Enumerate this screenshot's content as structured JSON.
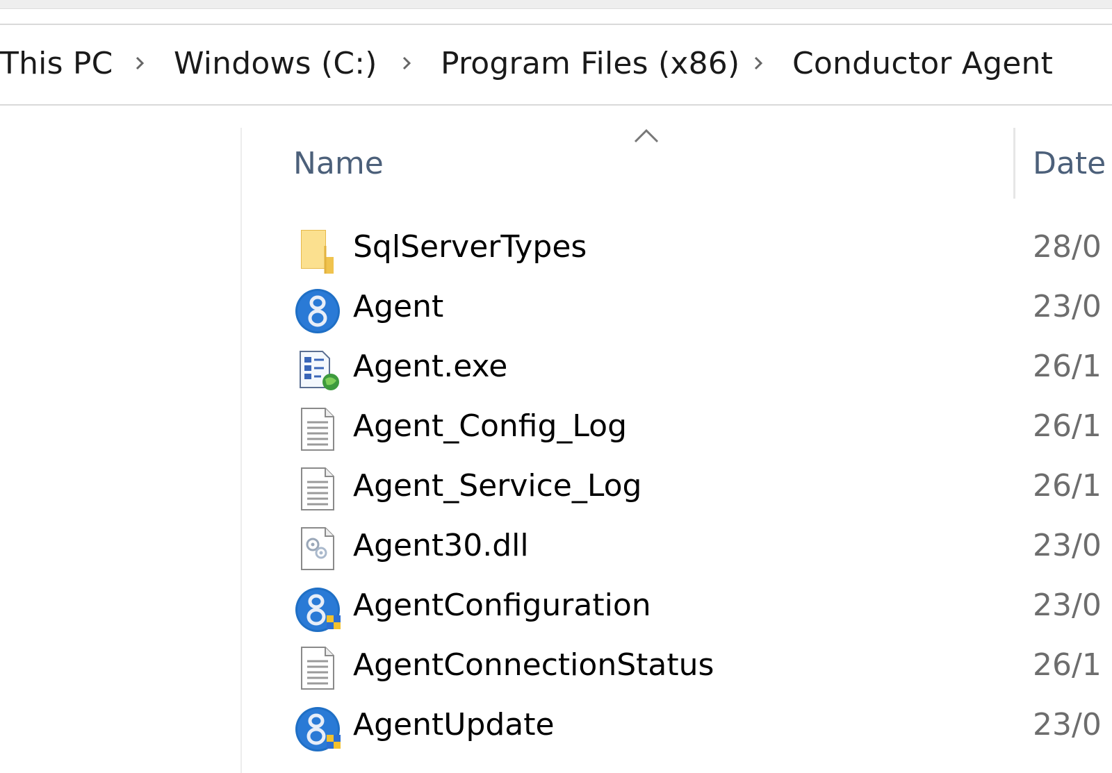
{
  "breadcrumb": {
    "items": [
      "This PC",
      "Windows (C:)",
      "Program Files (x86)",
      "Conductor Agent"
    ]
  },
  "columns": {
    "name": "Name",
    "date": "Date"
  },
  "files": [
    {
      "name": "SqlServerTypes",
      "date": "28/0",
      "icon": "folder-icon"
    },
    {
      "name": "Agent",
      "date": "23/0",
      "icon": "app-shortcut-icon"
    },
    {
      "name": "Agent.exe",
      "date": "26/1",
      "icon": "executable-icon"
    },
    {
      "name": "Agent_Config_Log",
      "date": "26/1",
      "icon": "text-file-icon"
    },
    {
      "name": "Agent_Service_Log",
      "date": "26/1",
      "icon": "text-file-icon"
    },
    {
      "name": "Agent30.dll",
      "date": "23/0",
      "icon": "dll-file-icon"
    },
    {
      "name": "AgentConfiguration",
      "date": "23/0",
      "icon": "admin-app-icon"
    },
    {
      "name": "AgentConnectionStatus",
      "date": "26/1",
      "icon": "text-file-icon"
    },
    {
      "name": "AgentUpdate",
      "date": "23/0",
      "icon": "admin-app-icon"
    }
  ],
  "colors": {
    "header_text": "#4c607a",
    "date_text": "#6d6d6d",
    "folder": "#f8d775",
    "app_blue": "#1f6fc5"
  }
}
